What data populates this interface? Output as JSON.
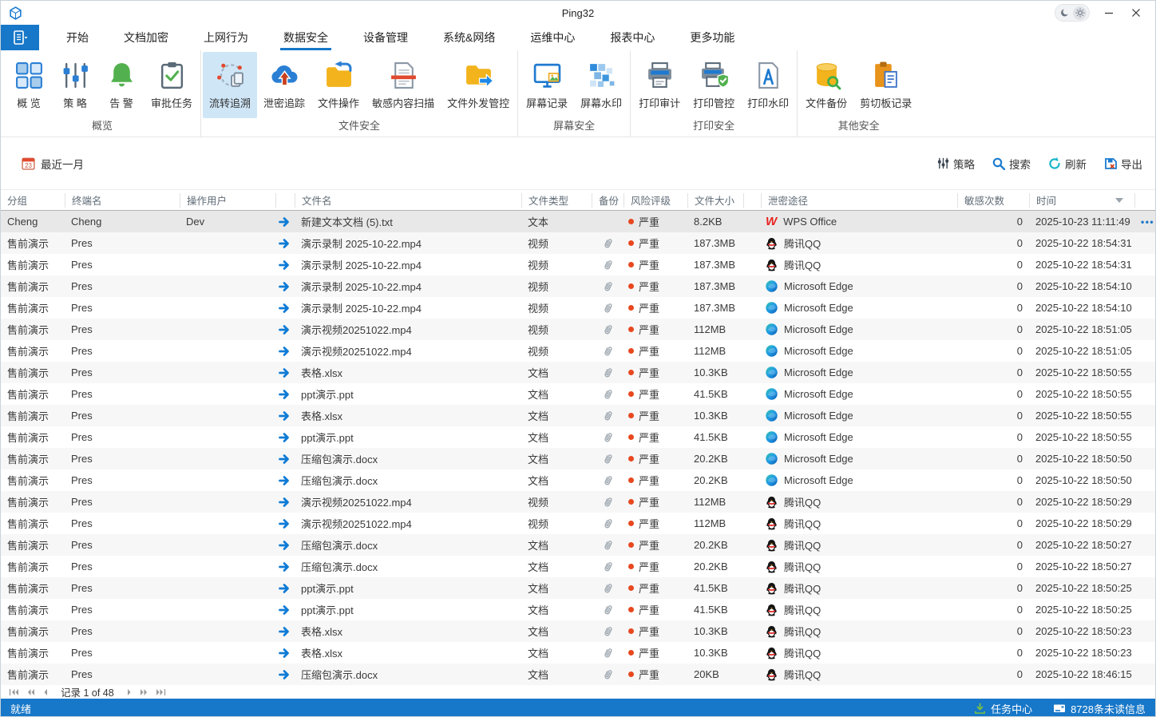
{
  "colors": {
    "accent": "#1777c8",
    "risk_red": "#e8481f",
    "selected_row": "#e8e8e8",
    "ribbon_selected": "#cfe6f7",
    "status_bar": "#1777c8"
  },
  "window": {
    "title": "Ping32"
  },
  "menu": {
    "active_tab": "数据安全",
    "tabs": [
      {
        "label": "开始"
      },
      {
        "label": "文档加密"
      },
      {
        "label": "上网行为"
      },
      {
        "label": "数据安全",
        "active": true
      },
      {
        "label": "设备管理"
      },
      {
        "label": "系统&网络"
      },
      {
        "label": "运维中心"
      },
      {
        "label": "报表中心"
      },
      {
        "label": "更多功能"
      }
    ]
  },
  "ribbon": {
    "groups": [
      {
        "label": "概览",
        "buttons": [
          {
            "label": "概 览",
            "icon": "overview"
          },
          {
            "label": "策 略",
            "icon": "policy"
          },
          {
            "label": "告 警",
            "icon": "alert"
          },
          {
            "label": "审批任务",
            "icon": "approval"
          }
        ]
      },
      {
        "label": "文件安全",
        "buttons": [
          {
            "label": "流转追溯",
            "icon": "trace",
            "selected": true
          },
          {
            "label": "泄密追踪",
            "icon": "leak"
          },
          {
            "label": "文件操作",
            "icon": "fileop"
          },
          {
            "label": "敏感内容扫描",
            "icon": "scan"
          },
          {
            "label": "文件外发管控",
            "icon": "outsend"
          }
        ]
      },
      {
        "label": "屏幕安全",
        "buttons": [
          {
            "label": "屏幕记录",
            "icon": "screenrec"
          },
          {
            "label": "屏幕水印",
            "icon": "screenwm"
          }
        ]
      },
      {
        "label": "打印安全",
        "buttons": [
          {
            "label": "打印审计",
            "icon": "printaudit"
          },
          {
            "label": "打印管控",
            "icon": "printctrl"
          },
          {
            "label": "打印水印",
            "icon": "printwm"
          }
        ]
      },
      {
        "label": "其他安全",
        "buttons": [
          {
            "label": "文件备份",
            "icon": "backup"
          },
          {
            "label": "剪切板记录",
            "icon": "cliprec"
          }
        ]
      }
    ]
  },
  "filter_bar": {
    "date_range": "最近一月",
    "calendar_day": "23",
    "actions": [
      {
        "label": "策略",
        "icon": "policy-sm"
      },
      {
        "label": "搜索",
        "icon": "search"
      },
      {
        "label": "刷新",
        "icon": "refresh"
      },
      {
        "label": "导出",
        "icon": "export"
      }
    ]
  },
  "table": {
    "columns": [
      {
        "label": "分组"
      },
      {
        "label": "终端名"
      },
      {
        "label": "操作用户"
      },
      {
        "label": ""
      },
      {
        "label": "文件名"
      },
      {
        "label": "文件类型"
      },
      {
        "label": "备份"
      },
      {
        "label": "风险评级"
      },
      {
        "label": "文件大小"
      },
      {
        "label": ""
      },
      {
        "label": "泄密途径"
      },
      {
        "label": "敏感次数"
      },
      {
        "label": "时间",
        "caret": true
      },
      {
        "label": ""
      }
    ],
    "rows": [
      {
        "group": "Cheng",
        "terminal": "Cheng",
        "user": "Dev",
        "file": "新建文本文档 (5).txt",
        "type": "文本",
        "backup": false,
        "risk": "严重",
        "size": "8.2KB",
        "channel": "WPS Office",
        "channel_icon": "wps",
        "count": "0",
        "time": "2025-10-23 11:11:49",
        "selected": true
      },
      {
        "group": "售前演示",
        "terminal": "Pres",
        "user": "",
        "file": "演示录制 2025-10-22.mp4",
        "type": "视频",
        "backup": true,
        "risk": "严重",
        "size": "187.3MB",
        "channel": "腾讯QQ",
        "channel_icon": "qq",
        "count": "0",
        "time": "2025-10-22 18:54:31"
      },
      {
        "group": "售前演示",
        "terminal": "Pres",
        "user": "",
        "file": "演示录制 2025-10-22.mp4",
        "type": "视频",
        "backup": true,
        "risk": "严重",
        "size": "187.3MB",
        "channel": "腾讯QQ",
        "channel_icon": "qq",
        "count": "0",
        "time": "2025-10-22 18:54:31"
      },
      {
        "group": "售前演示",
        "terminal": "Pres",
        "user": "",
        "file": "演示录制 2025-10-22.mp4",
        "type": "视频",
        "backup": true,
        "risk": "严重",
        "size": "187.3MB",
        "channel": "Microsoft Edge",
        "channel_icon": "edge",
        "count": "0",
        "time": "2025-10-22 18:54:10"
      },
      {
        "group": "售前演示",
        "terminal": "Pres",
        "user": "",
        "file": "演示录制 2025-10-22.mp4",
        "type": "视频",
        "backup": true,
        "risk": "严重",
        "size": "187.3MB",
        "channel": "Microsoft Edge",
        "channel_icon": "edge",
        "count": "0",
        "time": "2025-10-22 18:54:10"
      },
      {
        "group": "售前演示",
        "terminal": "Pres",
        "user": "",
        "file": "演示视频20251022.mp4",
        "type": "视频",
        "backup": true,
        "risk": "严重",
        "size": "112MB",
        "channel": "Microsoft Edge",
        "channel_icon": "edge",
        "count": "0",
        "time": "2025-10-22 18:51:05"
      },
      {
        "group": "售前演示",
        "terminal": "Pres",
        "user": "",
        "file": "演示视频20251022.mp4",
        "type": "视频",
        "backup": true,
        "risk": "严重",
        "size": "112MB",
        "channel": "Microsoft Edge",
        "channel_icon": "edge",
        "count": "0",
        "time": "2025-10-22 18:51:05"
      },
      {
        "group": "售前演示",
        "terminal": "Pres",
        "user": "",
        "file": "表格.xlsx",
        "type": "文档",
        "backup": true,
        "risk": "严重",
        "size": "10.3KB",
        "channel": "Microsoft Edge",
        "channel_icon": "edge",
        "count": "0",
        "time": "2025-10-22 18:50:55"
      },
      {
        "group": "售前演示",
        "terminal": "Pres",
        "user": "",
        "file": "ppt演示.ppt",
        "type": "文档",
        "backup": true,
        "risk": "严重",
        "size": "41.5KB",
        "channel": "Microsoft Edge",
        "channel_icon": "edge",
        "count": "0",
        "time": "2025-10-22 18:50:55"
      },
      {
        "group": "售前演示",
        "terminal": "Pres",
        "user": "",
        "file": "表格.xlsx",
        "type": "文档",
        "backup": true,
        "risk": "严重",
        "size": "10.3KB",
        "channel": "Microsoft Edge",
        "channel_icon": "edge",
        "count": "0",
        "time": "2025-10-22 18:50:55"
      },
      {
        "group": "售前演示",
        "terminal": "Pres",
        "user": "",
        "file": "ppt演示.ppt",
        "type": "文档",
        "backup": true,
        "risk": "严重",
        "size": "41.5KB",
        "channel": "Microsoft Edge",
        "channel_icon": "edge",
        "count": "0",
        "time": "2025-10-22 18:50:55"
      },
      {
        "group": "售前演示",
        "terminal": "Pres",
        "user": "",
        "file": "压缩包演示.docx",
        "type": "文档",
        "backup": true,
        "risk": "严重",
        "size": "20.2KB",
        "channel": "Microsoft Edge",
        "channel_icon": "edge",
        "count": "0",
        "time": "2025-10-22 18:50:50"
      },
      {
        "group": "售前演示",
        "terminal": "Pres",
        "user": "",
        "file": "压缩包演示.docx",
        "type": "文档",
        "backup": true,
        "risk": "严重",
        "size": "20.2KB",
        "channel": "Microsoft Edge",
        "channel_icon": "edge",
        "count": "0",
        "time": "2025-10-22 18:50:50"
      },
      {
        "group": "售前演示",
        "terminal": "Pres",
        "user": "",
        "file": "演示视频20251022.mp4",
        "type": "视频",
        "backup": true,
        "risk": "严重",
        "size": "112MB",
        "channel": "腾讯QQ",
        "channel_icon": "qq",
        "count": "0",
        "time": "2025-10-22 18:50:29"
      },
      {
        "group": "售前演示",
        "terminal": "Pres",
        "user": "",
        "file": "演示视频20251022.mp4",
        "type": "视频",
        "backup": true,
        "risk": "严重",
        "size": "112MB",
        "channel": "腾讯QQ",
        "channel_icon": "qq",
        "count": "0",
        "time": "2025-10-22 18:50:29"
      },
      {
        "group": "售前演示",
        "terminal": "Pres",
        "user": "",
        "file": "压缩包演示.docx",
        "type": "文档",
        "backup": true,
        "risk": "严重",
        "size": "20.2KB",
        "channel": "腾讯QQ",
        "channel_icon": "qq",
        "count": "0",
        "time": "2025-10-22 18:50:27"
      },
      {
        "group": "售前演示",
        "terminal": "Pres",
        "user": "",
        "file": "压缩包演示.docx",
        "type": "文档",
        "backup": true,
        "risk": "严重",
        "size": "20.2KB",
        "channel": "腾讯QQ",
        "channel_icon": "qq",
        "count": "0",
        "time": "2025-10-22 18:50:27"
      },
      {
        "group": "售前演示",
        "terminal": "Pres",
        "user": "",
        "file": "ppt演示.ppt",
        "type": "文档",
        "backup": true,
        "risk": "严重",
        "size": "41.5KB",
        "channel": "腾讯QQ",
        "channel_icon": "qq",
        "count": "0",
        "time": "2025-10-22 18:50:25"
      },
      {
        "group": "售前演示",
        "terminal": "Pres",
        "user": "",
        "file": "ppt演示.ppt",
        "type": "文档",
        "backup": true,
        "risk": "严重",
        "size": "41.5KB",
        "channel": "腾讯QQ",
        "channel_icon": "qq",
        "count": "0",
        "time": "2025-10-22 18:50:25"
      },
      {
        "group": "售前演示",
        "terminal": "Pres",
        "user": "",
        "file": "表格.xlsx",
        "type": "文档",
        "backup": true,
        "risk": "严重",
        "size": "10.3KB",
        "channel": "腾讯QQ",
        "channel_icon": "qq",
        "count": "0",
        "time": "2025-10-22 18:50:23"
      },
      {
        "group": "售前演示",
        "terminal": "Pres",
        "user": "",
        "file": "表格.xlsx",
        "type": "文档",
        "backup": true,
        "risk": "严重",
        "size": "10.3KB",
        "channel": "腾讯QQ",
        "channel_icon": "qq",
        "count": "0",
        "time": "2025-10-22 18:50:23"
      },
      {
        "group": "售前演示",
        "terminal": "Pres",
        "user": "",
        "file": "压缩包演示.docx",
        "type": "文档",
        "backup": true,
        "risk": "严重",
        "size": "20KB",
        "channel": "腾讯QQ",
        "channel_icon": "qq",
        "count": "0",
        "time": "2025-10-22 18:46:15"
      }
    ]
  },
  "pagination": {
    "label": "记录 1 of 48"
  },
  "status_bar": {
    "left": "就绪",
    "task_center": "任务中心",
    "messages": "8728条未读信息"
  }
}
